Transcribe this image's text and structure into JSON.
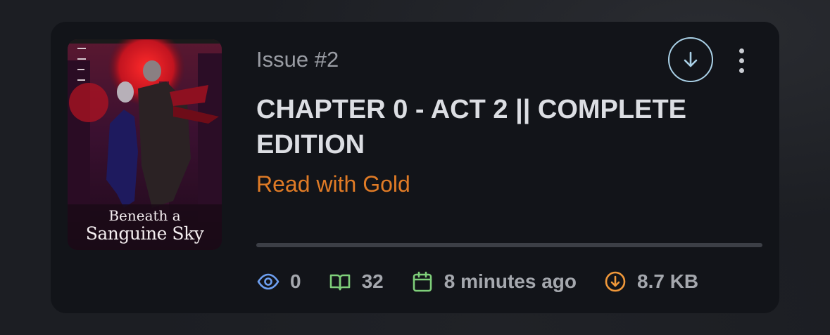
{
  "issue": {
    "number_label": "Issue #2",
    "title": "CHAPTER 0 - ACT 2 || COMPLETE EDITION",
    "gold_link": "Read with Gold",
    "cover": {
      "title_line1": "Beneath a",
      "title_line2": "Sanguine Sky"
    },
    "progress_fraction": 0,
    "stats": {
      "views": "0",
      "pages": "32",
      "published": "8 minutes ago",
      "size": "8.7 KB"
    }
  },
  "icons": {
    "download": "download-circle-icon",
    "menu": "more-vertical-icon",
    "views": "eye-icon",
    "pages": "book-open-icon",
    "published": "calendar-icon",
    "size": "download-icon"
  },
  "colors": {
    "background": "#1c1e23",
    "card": "#121419",
    "title": "#dcdee3",
    "muted": "#9a9da4",
    "gold": "#e07b26",
    "download_ring": "#a9d0e6",
    "eye_icon": "#6d9ff0",
    "book_icon": "#7fcf7a",
    "calendar_icon": "#7fcf7a",
    "size_icon": "#f0983a"
  }
}
